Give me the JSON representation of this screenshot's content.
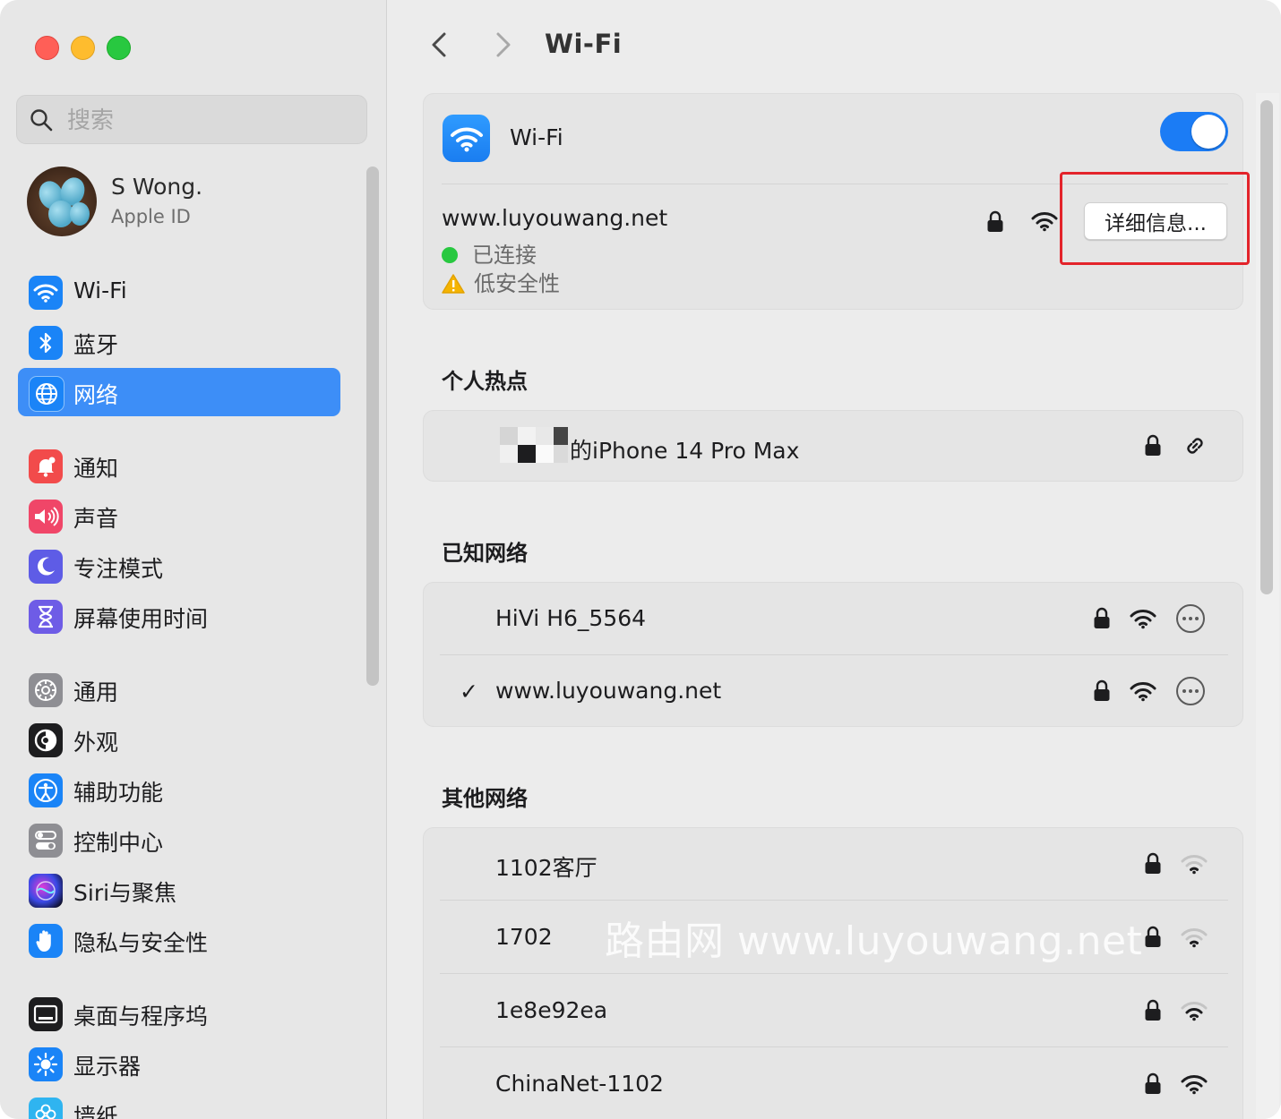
{
  "sidebar": {
    "search_placeholder": "搜索",
    "account": {
      "name": "S Wong.",
      "subtitle": "Apple ID"
    },
    "items": [
      {
        "label": "Wi-Fi",
        "icon": "wifi-icon",
        "color": "#1a84f7"
      },
      {
        "label": "蓝牙",
        "icon": "bluetooth-icon",
        "color": "#1a84f7"
      },
      {
        "label": "网络",
        "icon": "globe-icon",
        "color": "#1a84f7",
        "selected": true
      },
      {
        "label": "通知",
        "icon": "bell-icon",
        "color": "#f24b4b"
      },
      {
        "label": "声音",
        "icon": "speaker-icon",
        "color": "#f04668"
      },
      {
        "label": "专注模式",
        "icon": "moon-icon",
        "color": "#5e5ce6"
      },
      {
        "label": "屏幕使用时间",
        "icon": "hourglass-icon",
        "color": "#6e5ce6"
      },
      {
        "label": "通用",
        "icon": "gear-icon",
        "color": "#8e8e93"
      },
      {
        "label": "外观",
        "icon": "appearance-icon",
        "color": "#1d1d1f"
      },
      {
        "label": "辅助功能",
        "icon": "accessibility-icon",
        "color": "#1a84f7"
      },
      {
        "label": "控制中心",
        "icon": "toggles-icon",
        "color": "#8e8e93"
      },
      {
        "label": "Siri与聚焦",
        "icon": "siri-icon",
        "color": "#2a2a2a"
      },
      {
        "label": "隐私与安全性",
        "icon": "hand-icon",
        "color": "#1a84f7"
      },
      {
        "label": "桌面与程序坞",
        "icon": "dock-icon",
        "color": "#1d1d1f"
      },
      {
        "label": "显示器",
        "icon": "sun-icon",
        "color": "#1a84f7"
      },
      {
        "label": "墙纸",
        "icon": "flower-icon",
        "color": "#2fb4f0"
      }
    ]
  },
  "main": {
    "title": "Wi-Fi",
    "wifi_label": "Wi-Fi",
    "wifi_enabled": true,
    "current": {
      "name": "www.luyouwang.net",
      "status_connected": "已连接",
      "status_security": "低安全性",
      "details_button": "详细信息..."
    },
    "hotspot": {
      "title": "个人热点",
      "device": "的iPhone 14 Pro Max"
    },
    "known": {
      "title": "已知网络",
      "networks": [
        {
          "name": "HiVi H6_5564",
          "checked": false
        },
        {
          "name": "www.luyouwang.net",
          "checked": true
        }
      ],
      "checkmark": "✓"
    },
    "other": {
      "title": "其他网络",
      "networks": [
        {
          "name": "1102客厅",
          "signal": "weak"
        },
        {
          "name": "1702",
          "signal": "weak"
        },
        {
          "name": "1e8e92ea",
          "signal": "medium"
        },
        {
          "name": "ChinaNet-1102",
          "signal": "strong"
        }
      ]
    },
    "watermark": "路由网 www.luyouwang.net"
  }
}
